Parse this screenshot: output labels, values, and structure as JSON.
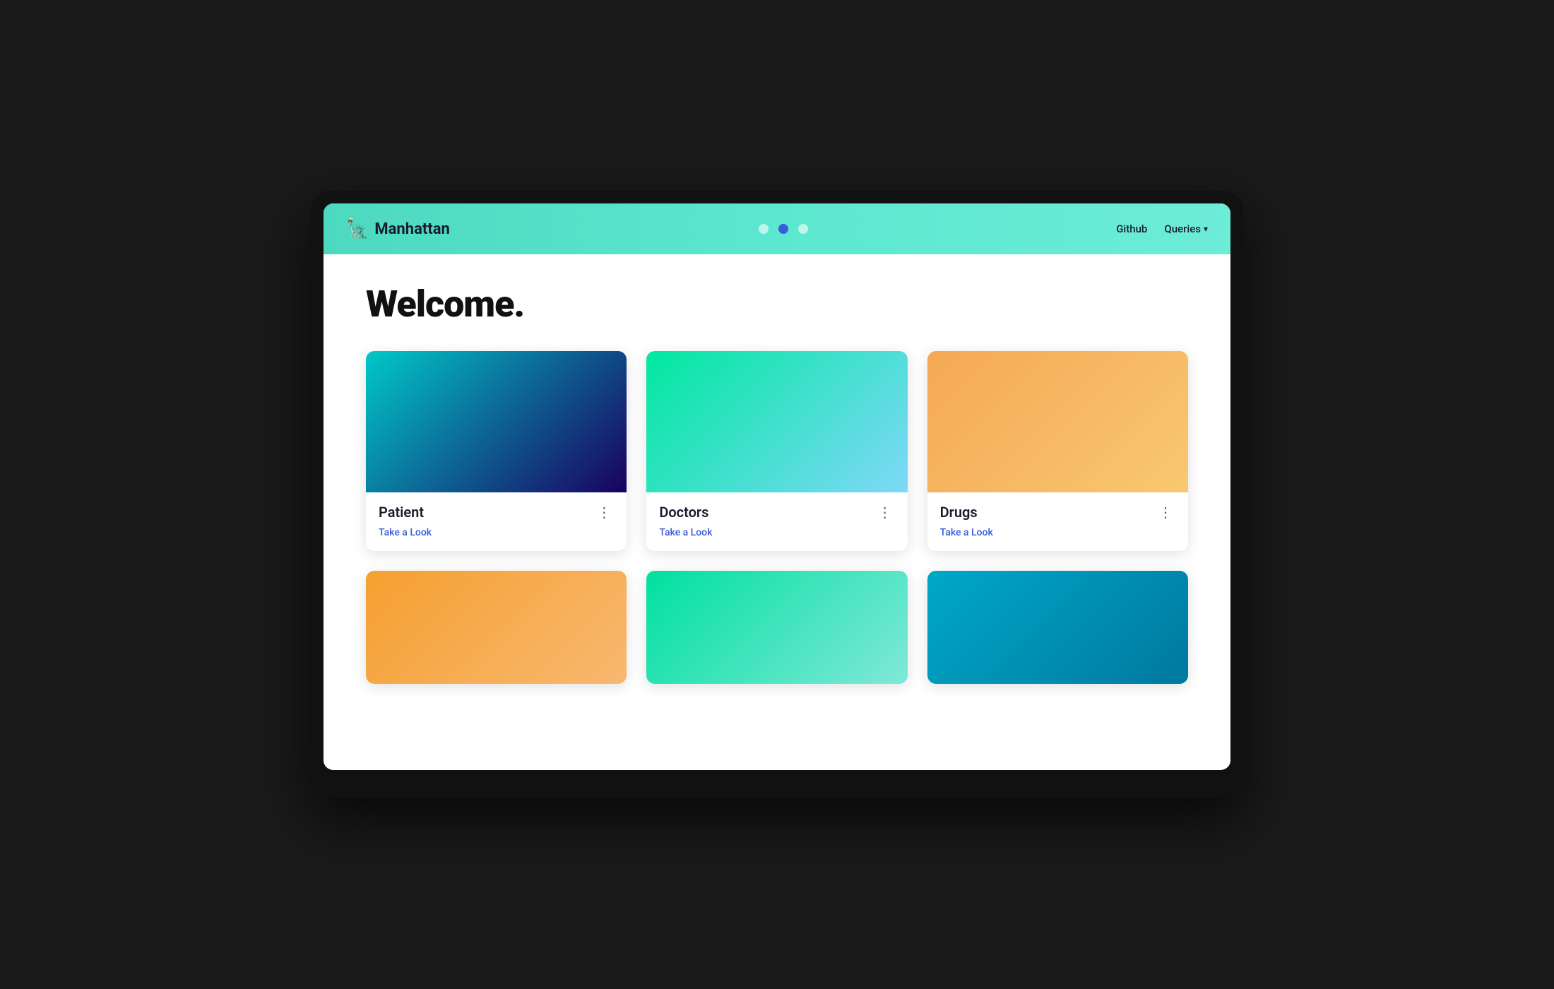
{
  "brand": {
    "icon": "🗽",
    "name": "Manhattan"
  },
  "navbar": {
    "dots": [
      {
        "id": "dot1",
        "active": false
      },
      {
        "id": "dot2",
        "active": true
      },
      {
        "id": "dot3",
        "active": false
      }
    ],
    "github_label": "Github",
    "queries_label": "Queries"
  },
  "page": {
    "title": "Welcome."
  },
  "cards": [
    {
      "id": "patient",
      "title": "Patient",
      "link_label": "Take a Look",
      "gradient_class": "grad-teal-purple"
    },
    {
      "id": "doctors",
      "title": "Doctors",
      "link_label": "Take a Look",
      "gradient_class": "grad-green-blue"
    },
    {
      "id": "drugs",
      "title": "Drugs",
      "link_label": "Take a Look",
      "gradient_class": "grad-orange-yellow"
    },
    {
      "id": "card4",
      "title": "",
      "link_label": "",
      "gradient_class": "grad-orange-peach",
      "partial": true
    },
    {
      "id": "card5",
      "title": "",
      "link_label": "",
      "gradient_class": "grad-green-teal",
      "partial": true
    },
    {
      "id": "card6",
      "title": "",
      "link_label": "",
      "gradient_class": "grad-teal-blue",
      "partial": true
    }
  ]
}
